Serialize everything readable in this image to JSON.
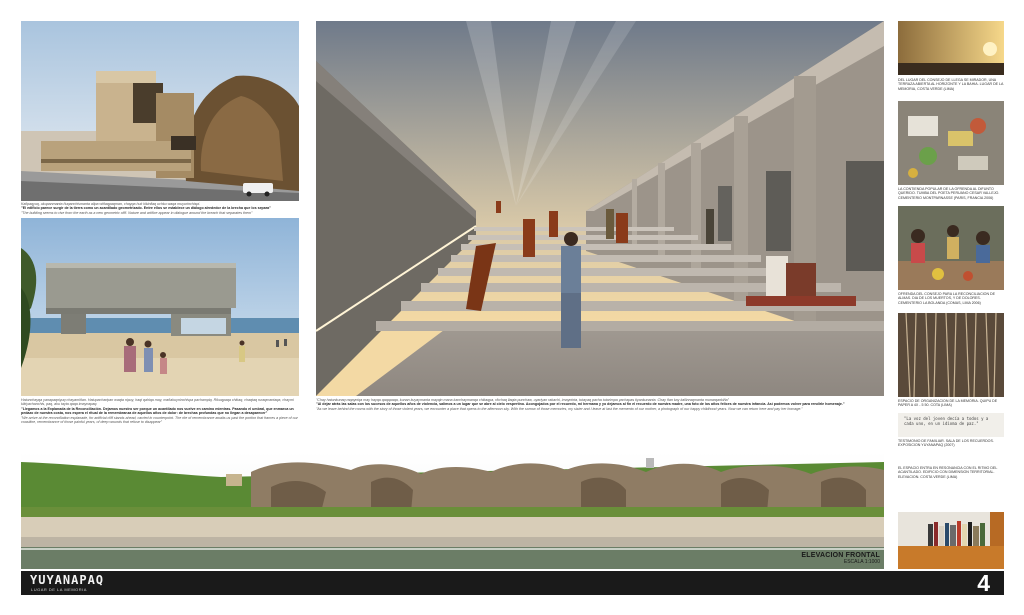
{
  "brand": {
    "logo_text": "YUYANAPAQ",
    "logo_subtitle": "LUGAR DE LA MEMORIA"
  },
  "page_number": "4",
  "elevation": {
    "title": "ELEVACION FRONTAL",
    "scale": "ESCALA 1:1000"
  },
  "captions": {
    "top_left": {
      "quechua": "Kallpaqyuq, ukupanmanta ñuqanchismanta allpa wiñaqpaqman, chayqa huk kikinllaq uchku waqa muyurinchispi.",
      "spanish": "\"El edificio parece surgir de la tierra como un acantilado geometrizado. Entre ellos se establece un diálogo alrededor de la brecha que los separa\"",
      "english": "\"The building seems to rise from the earth as a new geometric cliff. Nature and artifice appear in dialogue around the breach that separates them\""
    },
    "mid_left": {
      "quechua": "Hatunchayqa yanapaqniyuq chayamiñan. Hatupacharipan waqta nipuy, haqi qahiqa may, mañakuyninchispa pachampiq. Rikuqpaqa chikaq, chaqtaq ruraqmantaqa, chaymi kikiyachanchis, paq, aku tayta qaqa imaynapaq.",
      "spanish": "\"Llegamos a la Explanada de la Reconciliación. Dejamos nuestro ser porque un acantilado nos vuelve en camino mientras. Pasando el umbral, que enmarca un pedazo de nuestra costa, nos espera el ritual de la remembranza de aquellos años de dolor: de brechas profundas que no llegan a desaparecer\"",
      "english": "\"We arrive at the reconciliation esplanade, for artificial cliff stands ahead, carried in counterpoint. The rite of remembrance awaits us past the portion that frames a piece of our coastline, remembrance of those painful years, of deep wounds that refuse to disappear\""
    },
    "center": {
      "quechua": "\"Chay hatunkunaq raqayniqa may hayqa qaqapaqa, kunan kuyaymanta mayqin mana kanchaymanqa chikaqpa, rikchaq llaqta punchaw, uyariyan rakachi, imayninta, tutayaq pacha tutarimpa yachapas tiyankunanta. Chay ñan kay kallinraqmanta munarqankiña\"",
      "spanish": "\"Al dejar atrás las salas con los sucesos de aquellos años de violencia, salimos a un lugar que se abre al cielo vespertino. Acongojados por el recuerdo, mi hermana y yo dejamos al fin el recuerdo de nuestra madre, una foto de los años felices de nuestra infancia. Así podemos volver para rendirle homenaje.\"",
      "english": "\"As we leave behind the rooms with the story of those violent years, we encounter a place that opens to the afternoon sky. With the sorrow of those memories, my sister and I leave at last the memento of our mother, a photograph of our happy childhood years. Now we can return here and pay her homage.\""
    },
    "side": [
      "DEL LUGAR DEL CONSEJO DE LLEGA SE MIRADOR, UNA TERRAZA ABIERTA AL HORIZONTE Y LA BAHIA. LUGAR DE LA MEMORIA, COSTA VERDE (LIMA)",
      "LA CONTIENDA POPULAR DE LA OFRENDA AL DIFUNTO QUERIDO. TUMBA DEL POETA PERUANO CESAR VALLEJO. CEMENTERIO MONTPARNASSE (PARIS, FRANCIA 2006)",
      "OFRENDA DEL CONSEJO PARA LA RECONCILIACION DE ALMAS. DIA DE LOS MUERTOS, Y DE DOLORES. CEMENTERIO LA BOLANDA (COMAS, LIMA 2006)",
      "ESPACIO DE ORGANIZACION DE LA MEMORIA. QUIPU DE PAPER A 4X - 5 50. COTA (LIMA)",
      "TESTIMONIO DE FAMILIAR. SALA DE LOS RECUERDOS. EXPOSICION YUYANAPAQ (2007)",
      "EL ESPACIO ENTRA EN RESONANCIA CON EL RITMO DEL ACANTILADO. EDIFICIO CON DIMENSION TERRITORIAL. ELEVACION. COSTA VERDE (LIMA)"
    ],
    "quote_card": "\"La voz del joven decía a todos y a cada uno, en un idioma de paz.\""
  },
  "colors": {
    "brand_bar": "#1a1a1a",
    "sky": "#c9d8e8",
    "concrete": "#b8a58a",
    "grass": "#4f7a2f",
    "rust": "#8a3b1a"
  }
}
